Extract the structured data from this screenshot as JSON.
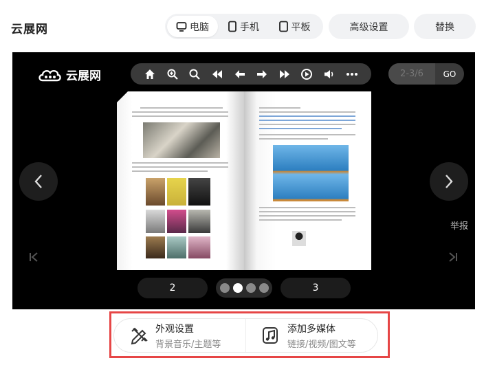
{
  "header": {
    "brand": "云展网",
    "devices": [
      {
        "label": "电脑",
        "icon": "monitor-icon",
        "active": true
      },
      {
        "label": "手机",
        "icon": "phone-icon",
        "active": false
      },
      {
        "label": "平板",
        "icon": "tablet-icon",
        "active": false
      }
    ],
    "advanced_settings": "高级设置",
    "replace": "替换"
  },
  "viewer": {
    "logo_text": "云展网",
    "toolbar_icons": [
      "home-icon",
      "zoom-in-icon",
      "search-icon",
      "first-page-icon",
      "prev-page-icon",
      "next-page-icon",
      "last-page-icon",
      "autoplay-icon",
      "volume-icon",
      "more-icon"
    ],
    "page_input_placeholder": "2-3/6",
    "go_label": "GO",
    "report_label": "举报",
    "left_page_number": "2",
    "right_page_number": "3",
    "dots_total": 4,
    "dots_active": 1,
    "colors": {
      "background": "#000000",
      "toolbar": "#3a3a3a"
    }
  },
  "actions": [
    {
      "title": "外观设置",
      "subtitle": "背景音乐/主题等",
      "icon": "pen-ruler-icon"
    },
    {
      "title": "添加多媒体",
      "subtitle": "链接/视频/图文等",
      "icon": "music-note-icon"
    }
  ],
  "colors": {
    "highlight_border": "#e64646",
    "pill_bg": "#f1f2f4"
  }
}
